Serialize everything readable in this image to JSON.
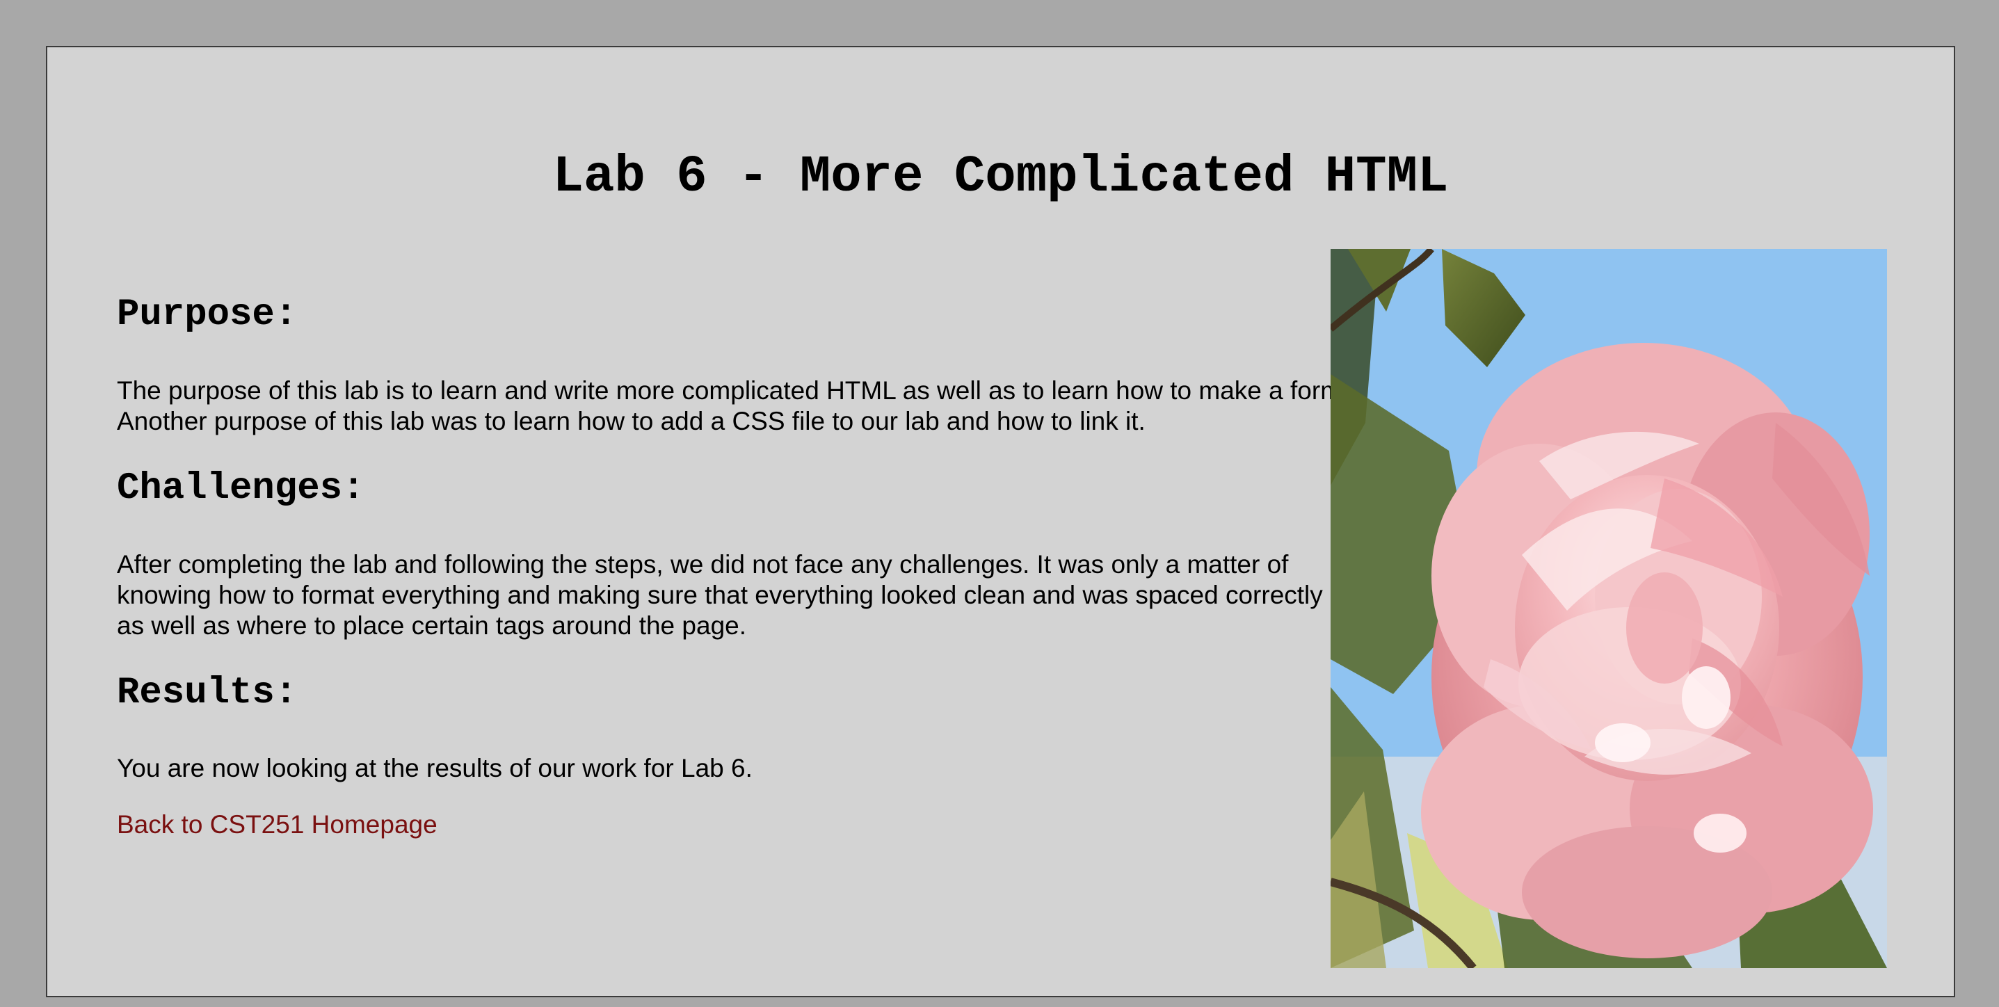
{
  "page": {
    "title": "Lab 6 - More Complicated HTML"
  },
  "sections": {
    "purpose": {
      "heading": "Purpose:",
      "text": "The purpose of this lab is to learn and write more complicated HTML as well as to learn how to make a form. Another purpose of this lab was to learn how to add a CSS file to our lab and how to link it."
    },
    "challenges": {
      "heading": "Challenges:",
      "text": "After completing the lab and following the steps, we did not face any challenges. It was only a matter of knowing how to format everything and making sure that everything looked clean and was spaced correctly as well as where to place certain tags around the page."
    },
    "results": {
      "heading": "Results:",
      "text": "You are now looking at the results of our work for Lab 6."
    }
  },
  "links": {
    "home": "Back to CST251 Homepage"
  },
  "image": {
    "icon": "flower-photo"
  },
  "colors": {
    "page_background": "#d3d3d3",
    "outer_background": "#a8a8a8",
    "link": "#7a1010",
    "text": "#000000"
  }
}
